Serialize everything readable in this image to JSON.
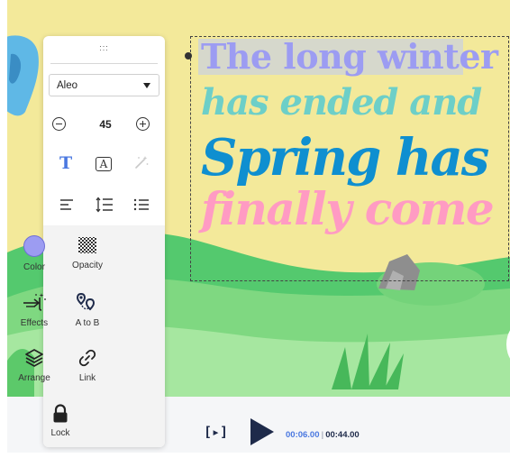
{
  "toolbar": {
    "drag_handle": ":::",
    "font": "Aleo",
    "font_size": "45",
    "tools": {
      "color": "Color",
      "opacity": "Opacity",
      "effects": "Effects",
      "a_to_b": "A to B",
      "arrange": "Arrange",
      "link": "Link",
      "lock": "Lock"
    },
    "current_color": "#9c9cf2",
    "icons": [
      "minus-icon",
      "plus-icon",
      "text-style-icon",
      "text-outline-icon",
      "magic-wand-icon",
      "align-left-icon",
      "line-height-icon",
      "list-icon",
      "color-swatch-icon",
      "opacity-checker-icon",
      "effects-icon",
      "path-icon",
      "layers-icon",
      "link-icon",
      "lock-icon"
    ]
  },
  "canvas": {
    "lines": [
      "The long winter",
      "has ended and",
      "Spring has",
      "finally come"
    ],
    "line_colors": [
      "#9c9cf2",
      "#6dcfc8",
      "#0f8fd0",
      "#ff9bc3"
    ],
    "background_color": "#f3e99a"
  },
  "playback": {
    "bracket_play": "[▸]",
    "current_time": "00:06.00",
    "total_time": "00:44.00"
  }
}
